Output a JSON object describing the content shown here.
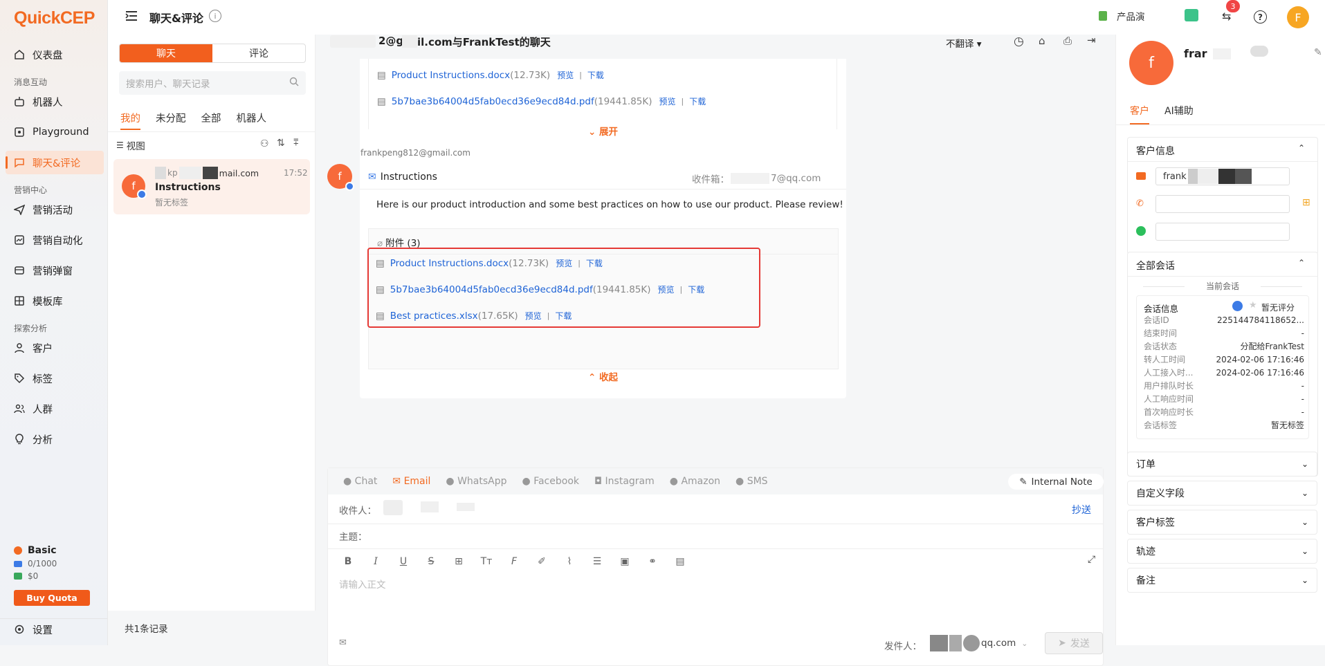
{
  "brand": {
    "logo_q": "Q",
    "logo_rest": "uick",
    "logo_cep": "CEP"
  },
  "nav": {
    "items": [
      {
        "label": "仪表盘",
        "icon": "house-icon"
      },
      {
        "section": "消息互动"
      },
      {
        "label": "机器人",
        "icon": "robot-icon"
      },
      {
        "label": "Playground",
        "icon": "playground-icon"
      },
      {
        "label": "聊天&评论",
        "icon": "chat-icon",
        "active": true
      },
      {
        "section": "营销中心"
      },
      {
        "label": "营销活动",
        "icon": "send-icon"
      },
      {
        "label": "营销自动化",
        "icon": "automation-icon"
      },
      {
        "label": "营销弹窗",
        "icon": "popup-icon"
      },
      {
        "label": "模板库",
        "icon": "template-icon"
      },
      {
        "section": "探索分析"
      },
      {
        "label": "客户",
        "icon": "user-icon"
      },
      {
        "label": "标签",
        "icon": "tag-icon"
      },
      {
        "label": "人群",
        "icon": "users-icon"
      },
      {
        "label": "分析",
        "icon": "bulb-icon"
      }
    ],
    "plan": {
      "name": "Basic",
      "quota": "0/1000",
      "balance": "$0",
      "buy": "Buy Quota"
    },
    "settings": "设置"
  },
  "topbar": {
    "title": "聊天&评论",
    "product_env": "产品演",
    "notif_count": "3",
    "avatar": "F"
  },
  "list": {
    "tab_chat": "聊天",
    "tab_comment": "评论",
    "search_placeholder": "搜索用户、聊天记录",
    "filters": [
      "我的",
      "未分配",
      "全部",
      "机器人"
    ],
    "view_label": "视图",
    "conversation": {
      "avatar": "f",
      "email": "mail.com",
      "email_prefix": "kp",
      "time": "17:52",
      "subject": "Instructions",
      "tag": "暂无标签"
    },
    "footer": "共1条记录"
  },
  "chat": {
    "header_title_a": "2@g",
    "header_title_b": "il.com与FrankTest的聊天",
    "translate": "不翻译",
    "prev_attachments": [
      {
        "name": "Product Instructions.docx",
        "size": "(12.73K)"
      },
      {
        "name": "5b7bae3b64004d5fab0ecd36e9ecd84d.pdf",
        "size": "(19441.85K)"
      }
    ],
    "expand": "展开",
    "sender": "frankpeng812@gmail.com",
    "msg_avatar": "f",
    "msg_subject": "Instructions",
    "inbox_label": "收件箱：",
    "inbox_value": "7@qq.com",
    "body": "Here is our product introduction and some best practices on how to use our product. Please review!",
    "attach_header": "附件 (3)",
    "attachments": [
      {
        "name": "Product Instructions.docx",
        "size": "(12.73K)"
      },
      {
        "name": "5b7bae3b64004d5fab0ecd36e9ecd84d.pdf",
        "size": "(19441.85K)"
      },
      {
        "name": "Best practices.xlsx",
        "size": "(17.65K)"
      }
    ],
    "preview": "预览",
    "download": "下载",
    "collapse": "收起"
  },
  "composer": {
    "channels": [
      {
        "label": "Chat",
        "icon": "chat-bubble-icon"
      },
      {
        "label": "Email",
        "icon": "envelope-icon",
        "active": true
      },
      {
        "label": "WhatsApp",
        "icon": "whatsapp-icon"
      },
      {
        "label": "Facebook",
        "icon": "facebook-icon"
      },
      {
        "label": "Instagram",
        "icon": "instagram-icon"
      },
      {
        "label": "Amazon",
        "icon": "amazon-icon"
      },
      {
        "label": "SMS",
        "icon": "sms-icon"
      }
    ],
    "internal_note": "Internal Note",
    "to_label": "收件人：",
    "cc": "抄送",
    "subject_label": "主题：",
    "body_placeholder": "请输入正文",
    "from_label": "发件人：",
    "from_value": "qq.com",
    "send": "发送"
  },
  "right": {
    "avatar": "f",
    "name": "frar",
    "tab_customer": "客户",
    "tab_ai": "AI辅助",
    "customer_info": "客户信息",
    "email_value": "frank",
    "all_sessions": "全部会话",
    "current_session": "当前会话",
    "session_info": "会话信息",
    "no_rating": "暂无评分",
    "rows": [
      {
        "k": "会话ID",
        "v": "2251447841186​52..."
      },
      {
        "k": "结束时间",
        "v": "-"
      },
      {
        "k": "会话状态",
        "v": "分配给FrankTest"
      },
      {
        "k": "转人工时间",
        "v": "2024-02-06 17:16:46"
      },
      {
        "k": "人工接入时...",
        "v": "2024-02-06 17:16:46"
      },
      {
        "k": "用户排队时长",
        "v": "-"
      },
      {
        "k": "人工响应时间",
        "v": "-"
      },
      {
        "k": "首次响应时长",
        "v": "-"
      },
      {
        "k": "会话标签",
        "v": "暂无标签"
      }
    ],
    "sections": [
      "订单",
      "自定义字段",
      "客户标签",
      "轨迹",
      "备注"
    ]
  }
}
